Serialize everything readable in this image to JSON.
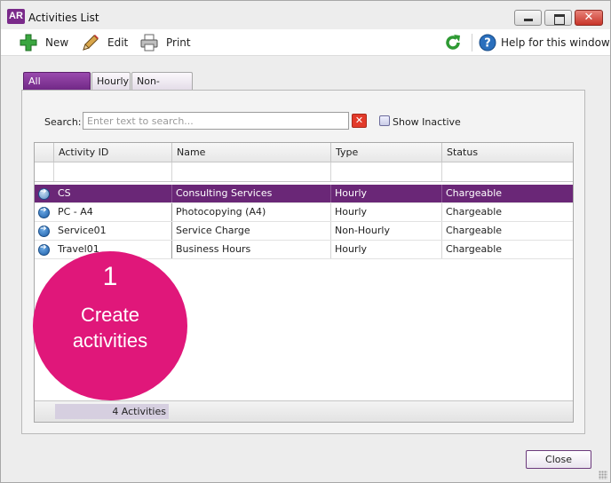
{
  "window": {
    "logo_text": "AR",
    "title": "Activities List",
    "controls": {
      "minimize": "minimize",
      "maximize": "maximize",
      "close": "✕"
    }
  },
  "toolbar": {
    "new_label": "New",
    "edit_label": "Edit",
    "print_label": "Print",
    "help_label": "Help for this window"
  },
  "tabs": [
    {
      "label": "All Activities",
      "active": true
    },
    {
      "label": "Hourly",
      "active": false
    },
    {
      "label": "Non-Hourly",
      "active": false
    }
  ],
  "search": {
    "label": "Search:",
    "value": "",
    "placeholder": "Enter text to search...",
    "clear_icon": "✕",
    "show_inactive_label": "Show Inactive",
    "show_inactive_checked": false
  },
  "grid": {
    "columns": [
      "Activity ID",
      "Name",
      "Type",
      "Status"
    ],
    "rows": [
      {
        "id": "CS",
        "name": "Consulting Services",
        "type": "Hourly",
        "status": "Chargeable",
        "selected": true
      },
      {
        "id": "PC - A4",
        "name": "Photocopying (A4)",
        "type": "Hourly",
        "status": "Chargeable",
        "selected": false
      },
      {
        "id": "Service01",
        "name": "Service Charge",
        "type": "Non-Hourly",
        "status": "Chargeable",
        "selected": false
      },
      {
        "id": "Travel01",
        "name": "Business Hours",
        "type": "Hourly",
        "status": "Chargeable",
        "selected": false
      }
    ],
    "footer_count": "4 Activities"
  },
  "callout": {
    "number": "1",
    "line1": "Create",
    "line2": "activities",
    "color": "#e0177a"
  },
  "close_button_label": "Close",
  "colors": {
    "accent": "#6a2777",
    "selected_row": "#6a2777"
  }
}
